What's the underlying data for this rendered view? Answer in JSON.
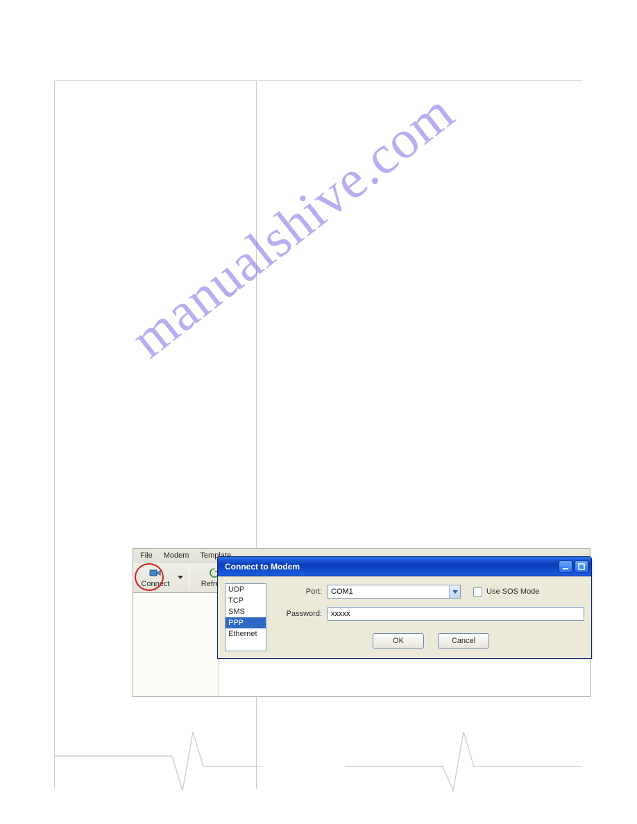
{
  "watermark": "manualshive.com",
  "menubar": {
    "file": "File",
    "modem": "Modem",
    "template": "Template"
  },
  "toolbar": {
    "connect": "Connect",
    "refresh": "Refresh"
  },
  "dialog": {
    "title": "Connect to Modem",
    "protocols": {
      "udp": "UDP",
      "tcp": "TCP",
      "sms": "SMS",
      "ppp": "PPP",
      "ethernet": "Ethernet"
    },
    "selected_protocol": "PPP",
    "port_label": "Port:",
    "port_value": "COM1",
    "password_label": "Password:",
    "password_value": "xxxxx",
    "sos_label": "Use SOS Mode",
    "ok": "OK",
    "cancel": "Cancel"
  }
}
